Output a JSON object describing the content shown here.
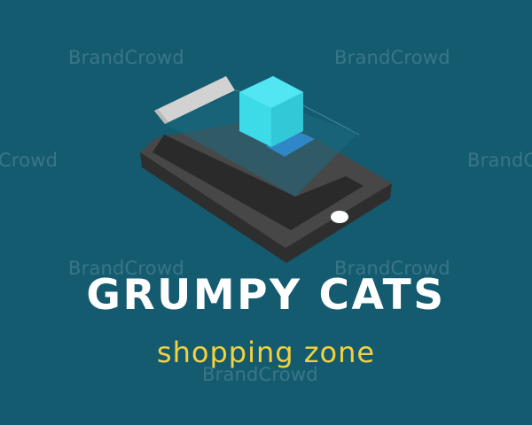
{
  "logo": {
    "name": "GRUMPY CATS",
    "tagline": "shopping zone"
  },
  "watermark": {
    "text": "BrandCrowd",
    "text_left_cut": "Crowd"
  },
  "colors": {
    "background": "#145b70",
    "phone_body": "#3a3a3a",
    "phone_screen": "#2b2b2b",
    "cube": "#3ddbe8",
    "brand_text": "#ffffff",
    "tagline": "#f4d13d"
  }
}
